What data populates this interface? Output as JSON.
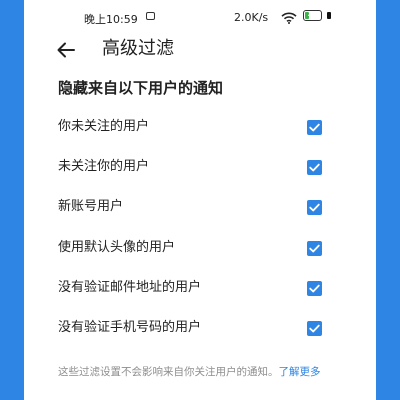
{
  "status_bar": {
    "time": "晚上10:59",
    "network_speed": "2.0K/s",
    "battery": "29"
  },
  "header": {
    "back_icon": "arrow-left-icon",
    "title": "高级过滤"
  },
  "section": {
    "title": "隐藏来自以下用户的通知"
  },
  "filters": [
    {
      "label": "你未关注的用户",
      "checked": true
    },
    {
      "label": "未关注你的用户",
      "checked": true
    },
    {
      "label": "新账号用户",
      "checked": true
    },
    {
      "label": "使用默认头像的用户",
      "checked": true
    },
    {
      "label": "没有验证邮件地址的用户",
      "checked": true
    },
    {
      "label": "没有验证手机号码的用户",
      "checked": true
    }
  ],
  "footer": {
    "text": "这些过滤设置不会影响来自你关注用户的通知。",
    "link": "了解更多"
  },
  "colors": {
    "accent": "#2f85e3",
    "text": "#222222",
    "muted": "#8e8e8e"
  }
}
